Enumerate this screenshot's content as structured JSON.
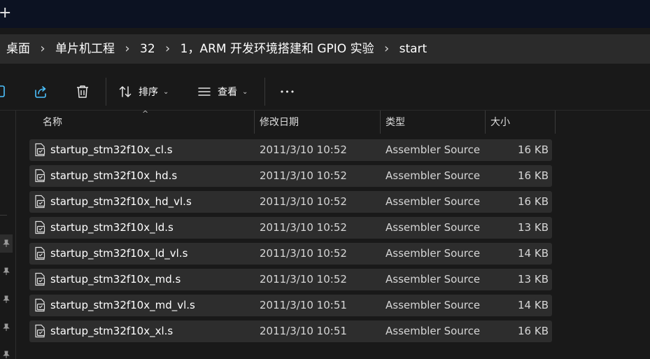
{
  "titlebar": {
    "new_tab_glyph": "+"
  },
  "breadcrumb": {
    "items": [
      "桌面",
      "单片机工程",
      "32",
      "1，ARM 开发环境搭建和 GPIO 实验",
      "start"
    ],
    "separator": "›"
  },
  "toolbar": {
    "sort_label": "排序",
    "view_label": "查看",
    "more_glyph": "•••",
    "icons": [
      "copy-icon",
      "share-icon",
      "delete-icon",
      "sort-icon",
      "view-icon",
      "more-icon"
    ]
  },
  "columns": {
    "name": "名称",
    "date": "修改日期",
    "type": "类型",
    "size": "大小"
  },
  "files": [
    {
      "name": "startup_stm32f10x_cl.s",
      "date": "2011/3/10 10:52",
      "type": "Assembler Source",
      "size": "16 KB"
    },
    {
      "name": "startup_stm32f10x_hd.s",
      "date": "2011/3/10 10:52",
      "type": "Assembler Source",
      "size": "16 KB"
    },
    {
      "name": "startup_stm32f10x_hd_vl.s",
      "date": "2011/3/10 10:52",
      "type": "Assembler Source",
      "size": "16 KB"
    },
    {
      "name": "startup_stm32f10x_ld.s",
      "date": "2011/3/10 10:52",
      "type": "Assembler Source",
      "size": "13 KB"
    },
    {
      "name": "startup_stm32f10x_ld_vl.s",
      "date": "2011/3/10 10:52",
      "type": "Assembler Source",
      "size": "14 KB"
    },
    {
      "name": "startup_stm32f10x_md.s",
      "date": "2011/3/10 10:52",
      "type": "Assembler Source",
      "size": "13 KB"
    },
    {
      "name": "startup_stm32f10x_md_vl.s",
      "date": "2011/3/10 10:51",
      "type": "Assembler Source",
      "size": "14 KB"
    },
    {
      "name": "startup_stm32f10x_xl.s",
      "date": "2011/3/10 10:51",
      "type": "Assembler Source",
      "size": "16 KB"
    }
  ],
  "colors": {
    "background": "#191919",
    "titlebar": "#0c1222",
    "addressbar": "#2b2b2b",
    "row": "#2d2d2d",
    "accent": "#4cc2ff"
  }
}
